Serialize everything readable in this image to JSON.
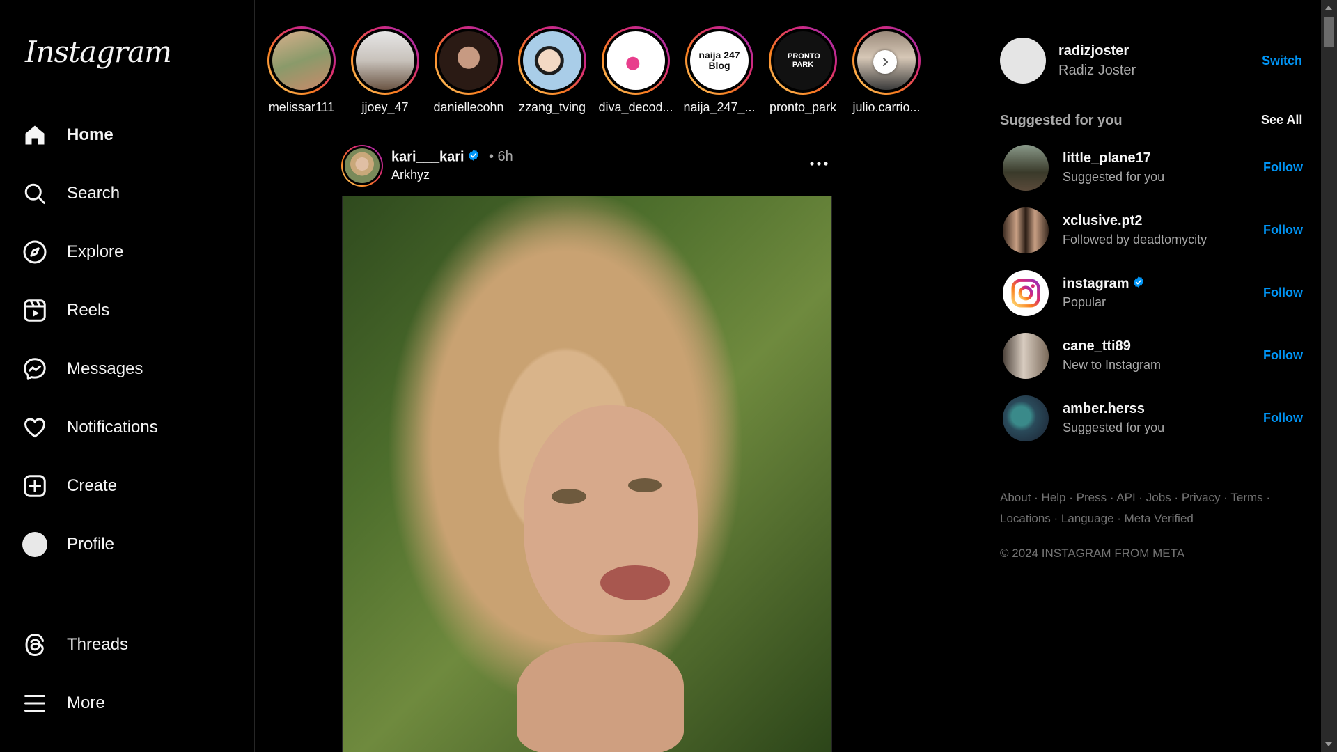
{
  "app": {
    "logo": "Instagram"
  },
  "nav": {
    "home": "Home",
    "search": "Search",
    "explore": "Explore",
    "reels": "Reels",
    "messages": "Messages",
    "notifications": "Notifications",
    "create": "Create",
    "profile": "Profile",
    "threads": "Threads",
    "more": "More"
  },
  "stories": [
    {
      "name": "melissar111"
    },
    {
      "name": "jjoey_47"
    },
    {
      "name": "daniellecohn"
    },
    {
      "name": "zzang_tving"
    },
    {
      "name": "diva_decod..."
    },
    {
      "name": "naija_247_...",
      "avatar_text": "naija 247 Blog"
    },
    {
      "name": "pronto_park",
      "avatar_text": "PRONTO PARK"
    },
    {
      "name": "julio.carrio..."
    }
  ],
  "post": {
    "username": "kari___kari",
    "time": "• 6h",
    "location": "Arkhyz"
  },
  "me": {
    "username": "radizjoster",
    "name": "Radiz Joster",
    "switch": "Switch"
  },
  "suggestions": {
    "title": "Suggested for you",
    "see_all": "See All",
    "items": [
      {
        "username": "little_plane17",
        "reason": "Suggested for you",
        "follow": "Follow"
      },
      {
        "username": "xclusive.pt2",
        "reason": "Followed by deadtomycity",
        "follow": "Follow"
      },
      {
        "username": "instagram",
        "reason": "Popular",
        "follow": "Follow"
      },
      {
        "username": "cane_tti89",
        "reason": "New to Instagram",
        "follow": "Follow"
      },
      {
        "username": "amber.herss",
        "reason": "Suggested for you",
        "follow": "Follow"
      }
    ]
  },
  "footer": {
    "links": [
      "About",
      "Help",
      "Press",
      "API",
      "Jobs",
      "Privacy",
      "Terms",
      "Locations",
      "Language",
      "Meta Verified"
    ],
    "copyright": "© 2024 INSTAGRAM FROM META"
  },
  "colors": {
    "accent": "#0095f6",
    "verified": "#0095f6",
    "background": "#000000"
  }
}
